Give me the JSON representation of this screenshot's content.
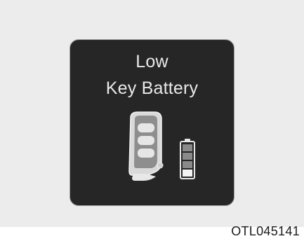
{
  "display": {
    "message_line_1": "Low",
    "message_line_2": "Key Battery",
    "icons": [
      "smart-key-fob-icon",
      "battery-low-icon"
    ]
  },
  "figure_code": "OTL045141"
}
